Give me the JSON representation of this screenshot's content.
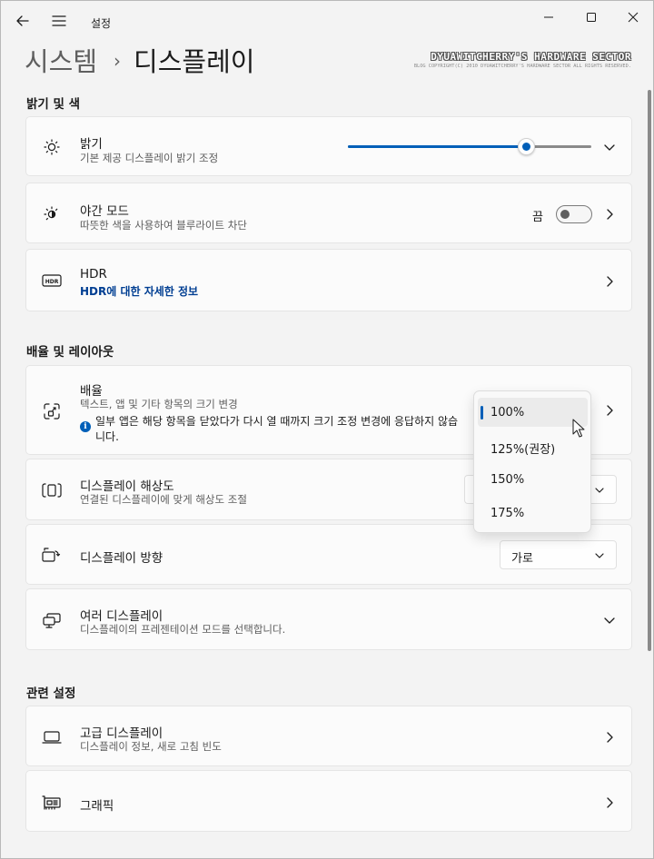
{
  "window": {
    "title": "설정",
    "back_icon": "back-arrow-icon",
    "menu_icon": "hamburger-menu-icon",
    "controls": [
      "minimize-icon",
      "maximize-icon",
      "close-icon"
    ]
  },
  "header": {
    "parent": "시스템",
    "separator": "›",
    "current": "디스플레이"
  },
  "watermark": {
    "main": "DYUAWITCHERRY'S HARDWARE SECTOR",
    "sub": "BLOG COPYRIGHT(C) 2010 DYUAWITCHERRY'S HARDWARE SECTOR ALL RIGHTS RESERVED."
  },
  "sections": {
    "brightness_color": "밝기 및 색",
    "scale_layout": "배율 및 레이아웃",
    "related": "관련 설정"
  },
  "brightness": {
    "title": "밝기",
    "subtitle": "기본 제공 디스플레이 밝기 조정",
    "value_fraction": 0.73,
    "icon": "sun-icon"
  },
  "night_mode": {
    "title": "야간 모드",
    "subtitle": "따뜻한 색을 사용하여 블루라이트 차단",
    "toggle_label": "끔",
    "on": false,
    "icon": "night-light-icon"
  },
  "hdr": {
    "title": "HDR",
    "link": "HDR에 대한 자세한 정보",
    "icon": "hdr-icon"
  },
  "scale": {
    "title": "배율",
    "subtitle": "텍스트, 앱 및 기타 항목의 크기 변경",
    "info": "일부 앱은 해당 항목을 닫았다가 다시 열 때까지 크기 조정 변경에 응답하지 않습니다.",
    "icon": "scale-icon",
    "options": [
      "100%",
      "125%(권장)",
      "150%",
      "175%"
    ],
    "selected": "100%"
  },
  "resolution": {
    "title": "디스플레이 해상도",
    "subtitle": "연결된 디스플레이에 맞게 해상도 조절",
    "icon": "resolution-icon"
  },
  "orientation": {
    "title": "디스플레이 방향",
    "value": "가로",
    "icon": "orientation-icon"
  },
  "multiple": {
    "title": "여러 디스플레이",
    "subtitle": "디스플레이의 프레젠테이션 모드를 선택합니다.",
    "icon": "multiple-displays-icon"
  },
  "advanced": {
    "title": "고급 디스플레이",
    "subtitle": "디스플레이 정보, 새로 고침 빈도",
    "icon": "laptop-icon"
  },
  "graphics": {
    "title": "그래픽",
    "icon": "graphics-card-icon"
  },
  "colors": {
    "accent": "#005fb8",
    "link": "#003e92"
  }
}
